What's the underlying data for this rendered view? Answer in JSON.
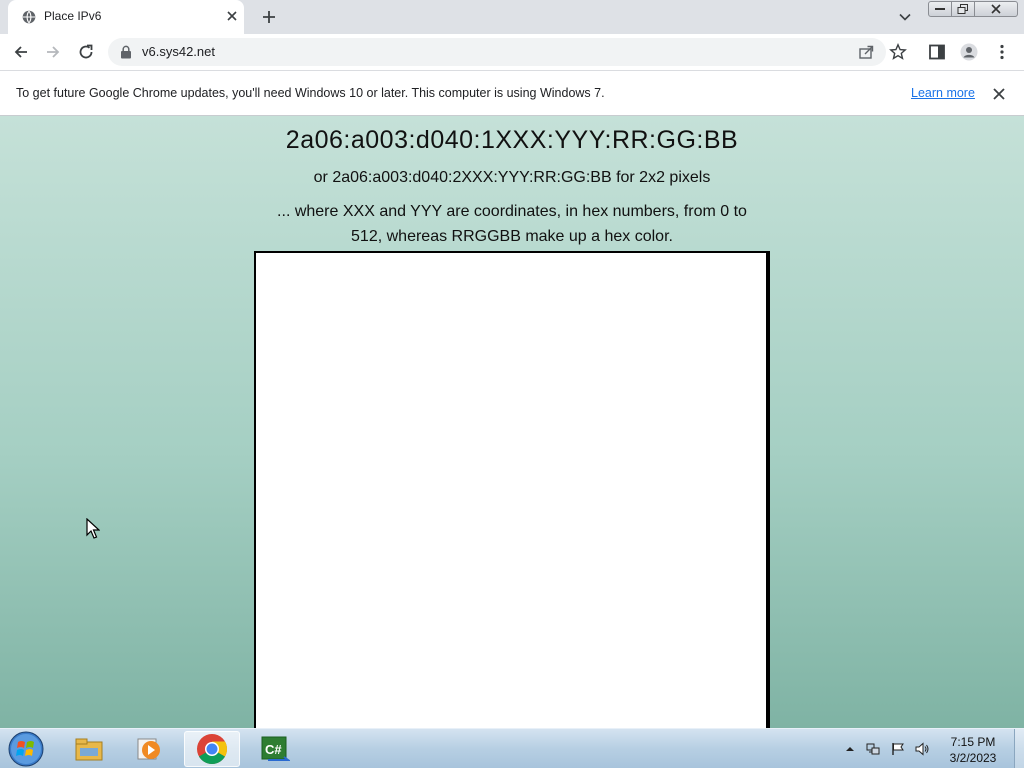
{
  "browser": {
    "tab_title": "Place IPv6",
    "url": "v6.sys42.net"
  },
  "infobar": {
    "message": "To get future Google Chrome updates, you'll need Windows 10 or later. This computer is using Windows 7.",
    "link": "Learn more"
  },
  "page": {
    "heading": "2a06:a003:d040:1XXX:YYY:RR:GG:BB",
    "subheading": "or 2a06:a003:d040:2XXX:YYY:RR:GG:BB for 2x2 pixels",
    "description": "... where XXX and YYY are coordinates, in hex numbers, from 0 to 512, whereas RRGGBB make up a hex color."
  },
  "taskbar": {
    "time": "7:15 PM",
    "date": "3/2/2023"
  },
  "colors": {
    "page_bg_top": "#c5e1d8",
    "page_bg_bottom": "#7fb3a4",
    "link": "#1a73e8"
  },
  "icons": [
    "globe-icon",
    "close-icon",
    "plus-icon",
    "chevron-down-icon",
    "back-icon",
    "forward-icon",
    "reload-icon",
    "lock-icon",
    "share-icon",
    "star-icon",
    "side-panel-icon",
    "profile-icon",
    "kebab-menu-icon",
    "windows-start-icon",
    "explorer-icon",
    "media-player-icon",
    "chrome-icon",
    "csharp-icon"
  ]
}
